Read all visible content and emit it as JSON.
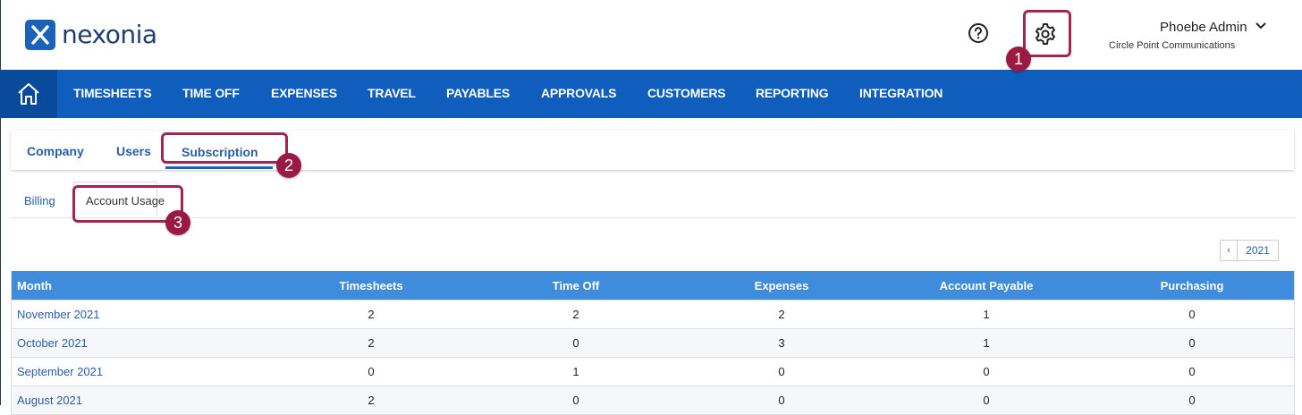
{
  "brand": {
    "name": "nexonia",
    "logo_mark": "X",
    "color": "#1a63b8"
  },
  "header": {
    "help_icon": "question-circle-icon",
    "settings_icon": "gear-icon",
    "user_name": "Phoebe Admin",
    "company": "Circle Point Communications"
  },
  "nav": {
    "home_icon": "home-icon",
    "items": [
      "TIMESHEETS",
      "TIME OFF",
      "EXPENSES",
      "TRAVEL",
      "PAYABLES",
      "APPROVALS",
      "CUSTOMERS",
      "REPORTING",
      "INTEGRATION"
    ],
    "background": "#0f5dbd"
  },
  "tabs": [
    "Company",
    "Users",
    "Subscription"
  ],
  "active_tab": "Subscription",
  "subtabs": [
    "Billing",
    "Account Usage"
  ],
  "active_subtab": "Account Usage",
  "year_pager": {
    "prev": "‹",
    "year": "2021"
  },
  "table": {
    "headers": [
      "Month",
      "Timesheets",
      "Time Off",
      "Expenses",
      "Account Payable",
      "Purchasing"
    ],
    "rows": [
      [
        "November 2021",
        "2",
        "2",
        "2",
        "1",
        "0"
      ],
      [
        "October 2021",
        "2",
        "0",
        "3",
        "1",
        "0"
      ],
      [
        "September 2021",
        "0",
        "1",
        "0",
        "0",
        "0"
      ],
      [
        "August 2021",
        "2",
        "0",
        "0",
        "0",
        "0"
      ]
    ]
  },
  "annotations": {
    "badges": [
      "1",
      "2",
      "3"
    ],
    "color": "#a3244f"
  }
}
